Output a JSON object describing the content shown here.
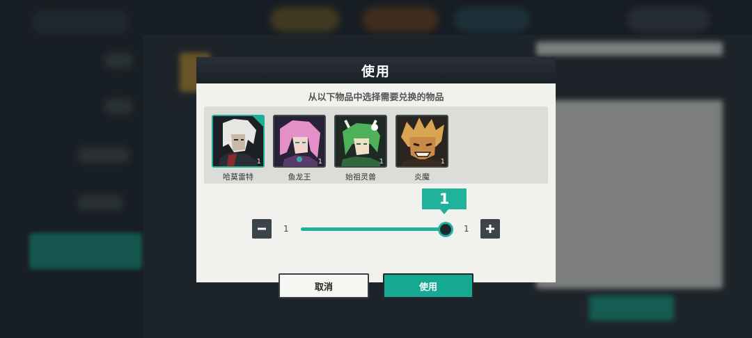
{
  "dialog": {
    "title": "使用",
    "prompt": "从以下物品中选择需要兑换的物品",
    "items": [
      {
        "name": "哈莫雷特",
        "quantity": "1",
        "selected": true,
        "icon": "white-haired-character-portrait"
      },
      {
        "name": "鱼龙王",
        "quantity": "1",
        "selected": false,
        "icon": "pink-haired-character-portrait"
      },
      {
        "name": "始祖灵兽",
        "quantity": "1",
        "selected": false,
        "icon": "green-horned-character-portrait"
      },
      {
        "name": "炎魔",
        "quantity": "1",
        "selected": false,
        "icon": "golden-spiky-character-portrait"
      }
    ],
    "slider": {
      "min_label": "1",
      "max_label": "1",
      "value": "1",
      "fill_fraction": 1.0
    },
    "cancel_label": "取消",
    "use_label": "使用"
  },
  "colors": {
    "accent": "#20b29b",
    "header": "#1c2128",
    "panel": "#f1f1ee"
  }
}
